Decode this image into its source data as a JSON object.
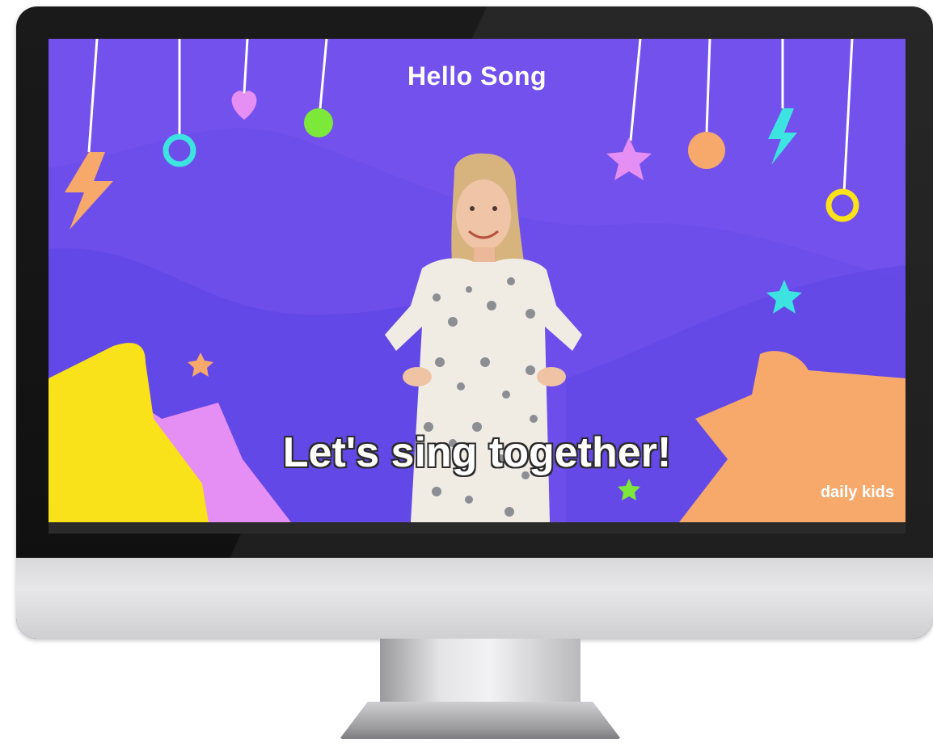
{
  "video": {
    "title": "Hello Song",
    "caption": "Let's sing together!",
    "brand": "daily kids"
  },
  "theme": {
    "background": "#6a4de8",
    "accent_orange": "#f7a86b",
    "accent_yellow": "#f9e21a",
    "accent_pink": "#e58ef4",
    "accent_cyan": "#3de3e0",
    "accent_green": "#7be83a"
  },
  "decorations": {
    "hanging_items": [
      "lightning-icon",
      "ring-icon",
      "heart-icon",
      "dot-icon",
      "star-icon",
      "dot-icon",
      "lightning-icon",
      "ring-icon"
    ],
    "floating_items": [
      "star-icon",
      "star-icon",
      "star-icon"
    ]
  },
  "presenter": {
    "description_icon": "presenter-figure"
  }
}
